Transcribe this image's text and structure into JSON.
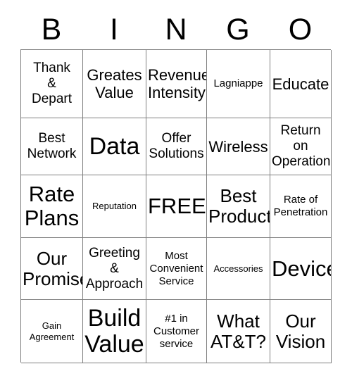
{
  "card": {
    "title": "BINGO",
    "header_letters": [
      "B",
      "I",
      "N",
      "G",
      "O"
    ],
    "free_space_label": "FREE!",
    "columns": 5,
    "rows": 5,
    "border_color": "#808080",
    "text_color": "#000000",
    "background_color": "#ffffff"
  },
  "cells": [
    [
      {
        "text": "Thank\n&\nDepart",
        "size": "md"
      },
      {
        "text": "Greates\nValue",
        "size": "lg"
      },
      {
        "text": "Revenue\nIntensity",
        "size": "lg"
      },
      {
        "text": "Lagniappe",
        "size": "sm"
      },
      {
        "text": "Educate",
        "size": "lg"
      }
    ],
    [
      {
        "text": "Best\nNetwork",
        "size": "md"
      },
      {
        "text": "Data",
        "size": "huge"
      },
      {
        "text": "Offer\nSolutions",
        "size": "md"
      },
      {
        "text": "Wireless",
        "size": "lg"
      },
      {
        "text": "Return on\nOperation",
        "size": "md"
      }
    ],
    [
      {
        "text": "Rate\nPlans",
        "size": "xxl"
      },
      {
        "text": "Reputation",
        "size": "xs"
      },
      {
        "text": "FREE!",
        "size": "xxl"
      },
      {
        "text": "Best\nProduct",
        "size": "xl"
      },
      {
        "text": "Rate of\nPenetration",
        "size": "sm"
      }
    ],
    [
      {
        "text": "Our\nPromise",
        "size": "xl"
      },
      {
        "text": "Greeting\n&\nApproach",
        "size": "md"
      },
      {
        "text": "Most\nConvenient\nService",
        "size": "sm"
      },
      {
        "text": "Accessories",
        "size": "xs"
      },
      {
        "text": "Device",
        "size": "xxl"
      }
    ],
    [
      {
        "text": "Gain\nAgreement",
        "size": "xs"
      },
      {
        "text": "Build\nValue",
        "size": "huge"
      },
      {
        "text": "#1 in\nCustomer\nservice",
        "size": "sm"
      },
      {
        "text": "What\nAT&T?",
        "size": "xl"
      },
      {
        "text": "Our\nVision",
        "size": "xl"
      }
    ]
  ]
}
